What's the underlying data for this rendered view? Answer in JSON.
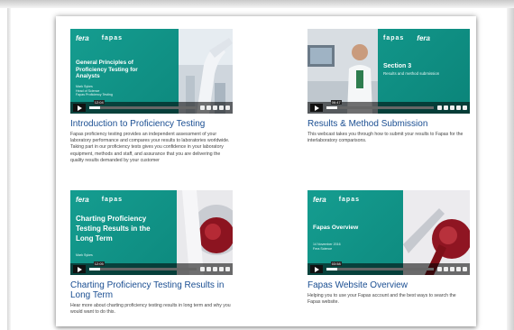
{
  "cards": [
    {
      "fera": "fera",
      "fapas": "fapas",
      "thumb_title": "General Principles of Proficiency Testing for Analysts",
      "thumb_sub": [
        "Mark Sykes",
        "Head of Science",
        "Fapas Proficiency Testing"
      ],
      "timestamp": "12:04",
      "title": "Introduction to Proficiency Testing",
      "description": "Fapas proficiency testing provides an independent assessment of your laboratory performance and compares your results to laboratories worldwide. Taking part in our proficiency tests gives you confidence in your laboratory equipment, methods and staff, and assurance that you are delivering the quality results demanded by your customer"
    },
    {
      "fera": "fera",
      "fapas": "fapas",
      "thumb_title": "Section 3",
      "thumb_sub": [
        "Results and method submission"
      ],
      "timestamp": "06:47",
      "title": "Results & Method Submission",
      "description": "This webcast takes you through how to submit your results to Fapas for the interlaboratory comparisons."
    },
    {
      "fera": "fera",
      "fapas": "fapas",
      "thumb_title": "Charting Proficiency Testing Results in the Long Term",
      "thumb_sub": [
        "Mark Sykes"
      ],
      "timestamp": "12:05",
      "title": "Charting Proficiency Testing Results in Long Term",
      "description": "Hear more about charting proficiency testing results in long term and why you would want to do this."
    },
    {
      "fera": "fera",
      "fapas": "fapas",
      "thumb_title": "Fapas Overview",
      "thumb_sub": [
        "14 November 2016",
        "Fera Science"
      ],
      "timestamp": "03:58",
      "title": "Fapas Website Overview",
      "description": "Helping you to use your Fapas account and the best ways to search the Fapas website."
    }
  ]
}
